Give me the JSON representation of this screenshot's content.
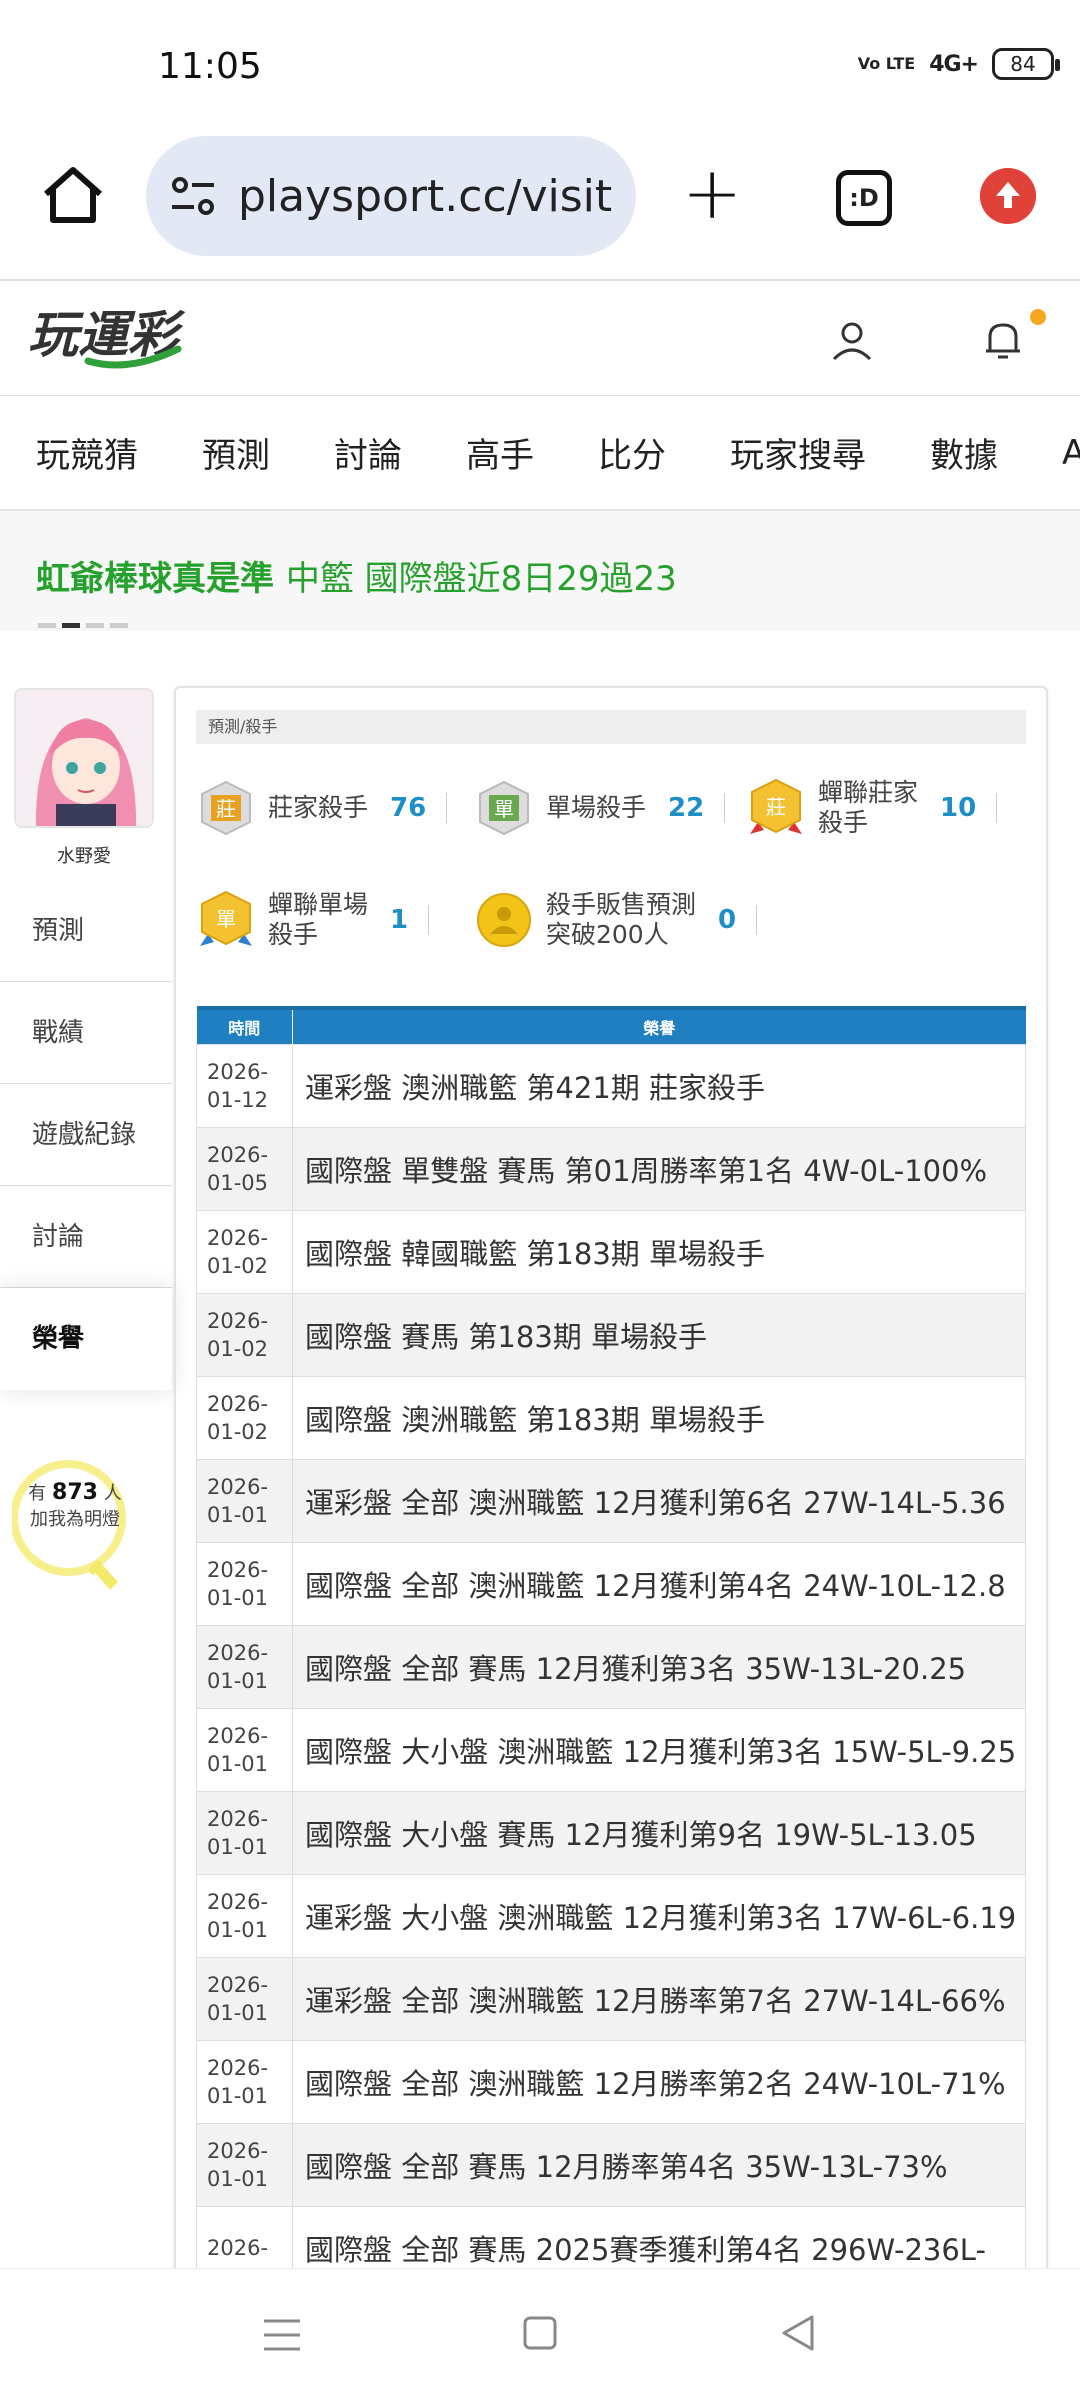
{
  "status_bar": {
    "time": "11:05",
    "volte": "Vo LTE",
    "network": "4G+",
    "battery": "84"
  },
  "browser": {
    "url": "playsport.cc/visit",
    "tabs_label": ":D"
  },
  "site": {
    "logo_text": "玩運彩"
  },
  "nav": {
    "items": [
      "玩競猜",
      "預測",
      "討論",
      "高手",
      "比分",
      "玩家搜尋",
      "數據",
      "APP"
    ]
  },
  "ticker": {
    "highlight": "虹爺棒球真是準",
    "text": "中籃 國際盤近8日29過23"
  },
  "sidebar": {
    "username": "水野愛",
    "items": [
      "預測",
      "戰績",
      "遊戲紀錄",
      "討論",
      "榮譽"
    ],
    "active": "榮譽",
    "follow_prefix": "有",
    "follow_count": "873",
    "follow_suffix": "人",
    "follow_cta": "加我為明燈"
  },
  "panel": {
    "crumb": "預測/殺手",
    "badges": [
      {
        "name_line1": "莊家殺手",
        "name_line2": "",
        "count": "76",
        "color": "#e8a020",
        "glyph": "莊"
      },
      {
        "name_line1": "單場殺手",
        "name_line2": "",
        "count": "22",
        "color": "#6aa84f",
        "glyph": "單"
      },
      {
        "name_line1": "蟬聯莊家",
        "name_line2": "殺手",
        "count": "10",
        "color": "#e8a020",
        "glyph": "莊"
      },
      {
        "name_line1": "蟬聯單場",
        "name_line2": "殺手",
        "count": "1",
        "color": "#e8a020",
        "glyph": "單"
      },
      {
        "name_line1": "殺手販售預測",
        "name_line2": "突破200人",
        "count": "0",
        "color": "#e8b820",
        "glyph": "●"
      }
    ],
    "table": {
      "headers": [
        "時間",
        "榮譽"
      ],
      "rows": [
        {
          "date1": "2026-",
          "date2": "01-12",
          "honor": "運彩盤 澳洲職籃 第421期 莊家殺手"
        },
        {
          "date1": "2026-",
          "date2": "01-05",
          "honor": "國際盤 單雙盤 賽馬 第01周勝率第1名 4W-0L-100%"
        },
        {
          "date1": "2026-",
          "date2": "01-02",
          "honor": "國際盤 韓國職籃 第183期 單場殺手"
        },
        {
          "date1": "2026-",
          "date2": "01-02",
          "honor": "國際盤 賽馬 第183期 單場殺手"
        },
        {
          "date1": "2026-",
          "date2": "01-02",
          "honor": "國際盤 澳洲職籃 第183期 單場殺手"
        },
        {
          "date1": "2026-",
          "date2": "01-01",
          "honor": "運彩盤 全部 澳洲職籃 12月獲利第6名 27W-14L-5.36"
        },
        {
          "date1": "2026-",
          "date2": "01-01",
          "honor": "國際盤 全部 澳洲職籃 12月獲利第4名 24W-10L-12.8"
        },
        {
          "date1": "2026-",
          "date2": "01-01",
          "honor": "國際盤 全部 賽馬 12月獲利第3名 35W-13L-20.25"
        },
        {
          "date1": "2026-",
          "date2": "01-01",
          "honor": "國際盤 大小盤 澳洲職籃 12月獲利第3名 15W-5L-9.25"
        },
        {
          "date1": "2026-",
          "date2": "01-01",
          "honor": "國際盤 大小盤 賽馬 12月獲利第9名 19W-5L-13.05"
        },
        {
          "date1": "2026-",
          "date2": "01-01",
          "honor": "運彩盤 大小盤 澳洲職籃 12月獲利第3名 17W-6L-6.19"
        },
        {
          "date1": "2026-",
          "date2": "01-01",
          "honor": "運彩盤 全部 澳洲職籃 12月勝率第7名 27W-14L-66%"
        },
        {
          "date1": "2026-",
          "date2": "01-01",
          "honor": "國際盤 全部 澳洲職籃 12月勝率第2名 24W-10L-71%"
        },
        {
          "date1": "2026-",
          "date2": "01-01",
          "honor": "國際盤 全部 賽馬 12月勝率第4名 35W-13L-73%"
        },
        {
          "date1": "2026-",
          "date2": "",
          "honor": "國際盤 全部 賽馬 2025賽季獲利第4名 296W-236L-"
        }
      ]
    }
  }
}
